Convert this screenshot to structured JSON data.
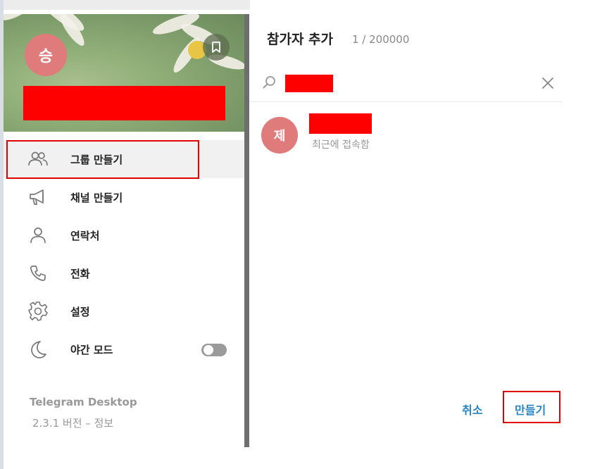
{
  "sidebar": {
    "avatar_initial": "승",
    "menu": [
      {
        "label": "그룹 만들기",
        "icon": "group-icon"
      },
      {
        "label": "채널 만들기",
        "icon": "megaphone-icon"
      },
      {
        "label": "연락처",
        "icon": "person-icon"
      },
      {
        "label": "전화",
        "icon": "phone-icon"
      },
      {
        "label": "설정",
        "icon": "gear-icon"
      },
      {
        "label": "야간 모드",
        "icon": "moon-icon"
      }
    ],
    "night_mode_on": false,
    "app_name": "Telegram Desktop",
    "version_text": "2.3.1 버전 – 정보"
  },
  "dialog": {
    "title": "참가자 추가",
    "count": "1 / 200000",
    "contact": {
      "avatar_initial": "제",
      "status": "최근에 접속함"
    },
    "cancel_label": "취소",
    "create_label": "만들기"
  },
  "colors": {
    "accent": "#2a86c2",
    "avatar": "#e07b7b",
    "highlight": "#e00000"
  }
}
